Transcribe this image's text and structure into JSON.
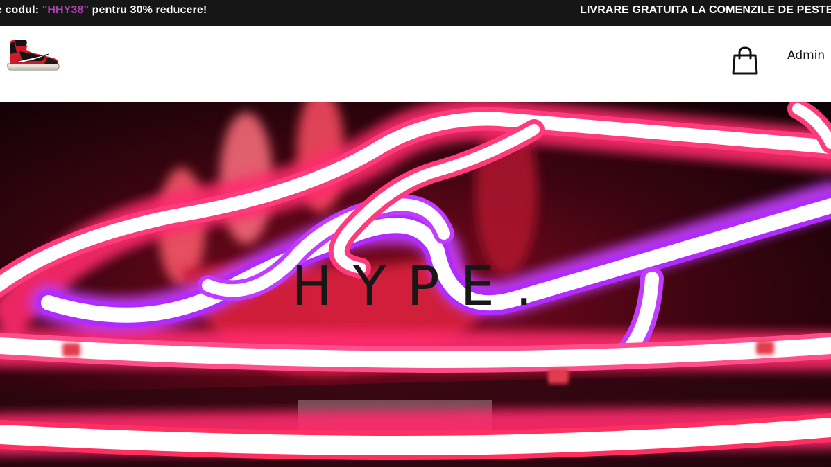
{
  "announcement": {
    "promo_prefix": "e codul: ",
    "promo_code": "\"HHY38\"",
    "promo_suffix": " pentru 30% reducere!",
    "shipping_text": "LIVRARE GRATUITA LA COMENZILE DE PESTE"
  },
  "header": {
    "logo_icon": "sneaker-logo-icon",
    "cart_icon": "shopping-bag-icon",
    "admin_label": "Admin"
  },
  "hero": {
    "title": "HYPE."
  },
  "colors": {
    "topbar_bg": "#161616",
    "promo_accent": "#b03fb0",
    "neon_pink": "#ff2a6d",
    "neon_purple": "#c23cff"
  }
}
